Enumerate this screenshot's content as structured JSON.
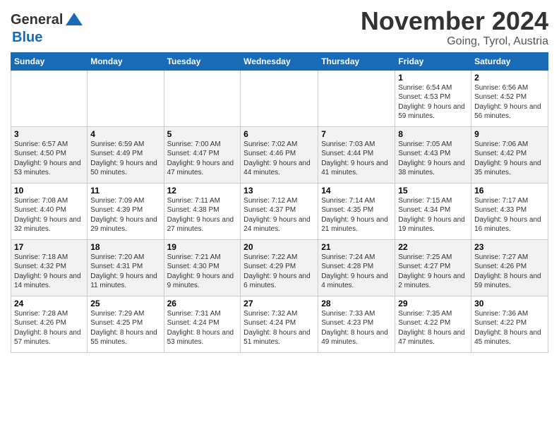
{
  "header": {
    "logo_general": "General",
    "logo_blue": "Blue",
    "month_title": "November 2024",
    "location": "Going, Tyrol, Austria"
  },
  "weekdays": [
    "Sunday",
    "Monday",
    "Tuesday",
    "Wednesday",
    "Thursday",
    "Friday",
    "Saturday"
  ],
  "weeks": [
    [
      {
        "day": "",
        "info": ""
      },
      {
        "day": "",
        "info": ""
      },
      {
        "day": "",
        "info": ""
      },
      {
        "day": "",
        "info": ""
      },
      {
        "day": "",
        "info": ""
      },
      {
        "day": "1",
        "info": "Sunrise: 6:54 AM\nSunset: 4:53 PM\nDaylight: 9 hours\nand 59 minutes."
      },
      {
        "day": "2",
        "info": "Sunrise: 6:56 AM\nSunset: 4:52 PM\nDaylight: 9 hours\nand 56 minutes."
      }
    ],
    [
      {
        "day": "3",
        "info": "Sunrise: 6:57 AM\nSunset: 4:50 PM\nDaylight: 9 hours\nand 53 minutes."
      },
      {
        "day": "4",
        "info": "Sunrise: 6:59 AM\nSunset: 4:49 PM\nDaylight: 9 hours\nand 50 minutes."
      },
      {
        "day": "5",
        "info": "Sunrise: 7:00 AM\nSunset: 4:47 PM\nDaylight: 9 hours\nand 47 minutes."
      },
      {
        "day": "6",
        "info": "Sunrise: 7:02 AM\nSunset: 4:46 PM\nDaylight: 9 hours\nand 44 minutes."
      },
      {
        "day": "7",
        "info": "Sunrise: 7:03 AM\nSunset: 4:44 PM\nDaylight: 9 hours\nand 41 minutes."
      },
      {
        "day": "8",
        "info": "Sunrise: 7:05 AM\nSunset: 4:43 PM\nDaylight: 9 hours\nand 38 minutes."
      },
      {
        "day": "9",
        "info": "Sunrise: 7:06 AM\nSunset: 4:42 PM\nDaylight: 9 hours\nand 35 minutes."
      }
    ],
    [
      {
        "day": "10",
        "info": "Sunrise: 7:08 AM\nSunset: 4:40 PM\nDaylight: 9 hours\nand 32 minutes."
      },
      {
        "day": "11",
        "info": "Sunrise: 7:09 AM\nSunset: 4:39 PM\nDaylight: 9 hours\nand 29 minutes."
      },
      {
        "day": "12",
        "info": "Sunrise: 7:11 AM\nSunset: 4:38 PM\nDaylight: 9 hours\nand 27 minutes."
      },
      {
        "day": "13",
        "info": "Sunrise: 7:12 AM\nSunset: 4:37 PM\nDaylight: 9 hours\nand 24 minutes."
      },
      {
        "day": "14",
        "info": "Sunrise: 7:14 AM\nSunset: 4:35 PM\nDaylight: 9 hours\nand 21 minutes."
      },
      {
        "day": "15",
        "info": "Sunrise: 7:15 AM\nSunset: 4:34 PM\nDaylight: 9 hours\nand 19 minutes."
      },
      {
        "day": "16",
        "info": "Sunrise: 7:17 AM\nSunset: 4:33 PM\nDaylight: 9 hours\nand 16 minutes."
      }
    ],
    [
      {
        "day": "17",
        "info": "Sunrise: 7:18 AM\nSunset: 4:32 PM\nDaylight: 9 hours\nand 14 minutes."
      },
      {
        "day": "18",
        "info": "Sunrise: 7:20 AM\nSunset: 4:31 PM\nDaylight: 9 hours\nand 11 minutes."
      },
      {
        "day": "19",
        "info": "Sunrise: 7:21 AM\nSunset: 4:30 PM\nDaylight: 9 hours\nand 9 minutes."
      },
      {
        "day": "20",
        "info": "Sunrise: 7:22 AM\nSunset: 4:29 PM\nDaylight: 9 hours\nand 6 minutes."
      },
      {
        "day": "21",
        "info": "Sunrise: 7:24 AM\nSunset: 4:28 PM\nDaylight: 9 hours\nand 4 minutes."
      },
      {
        "day": "22",
        "info": "Sunrise: 7:25 AM\nSunset: 4:27 PM\nDaylight: 9 hours\nand 2 minutes."
      },
      {
        "day": "23",
        "info": "Sunrise: 7:27 AM\nSunset: 4:26 PM\nDaylight: 8 hours\nand 59 minutes."
      }
    ],
    [
      {
        "day": "24",
        "info": "Sunrise: 7:28 AM\nSunset: 4:26 PM\nDaylight: 8 hours\nand 57 minutes."
      },
      {
        "day": "25",
        "info": "Sunrise: 7:29 AM\nSunset: 4:25 PM\nDaylight: 8 hours\nand 55 minutes."
      },
      {
        "day": "26",
        "info": "Sunrise: 7:31 AM\nSunset: 4:24 PM\nDaylight: 8 hours\nand 53 minutes."
      },
      {
        "day": "27",
        "info": "Sunrise: 7:32 AM\nSunset: 4:24 PM\nDaylight: 8 hours\nand 51 minutes."
      },
      {
        "day": "28",
        "info": "Sunrise: 7:33 AM\nSunset: 4:23 PM\nDaylight: 8 hours\nand 49 minutes."
      },
      {
        "day": "29",
        "info": "Sunrise: 7:35 AM\nSunset: 4:22 PM\nDaylight: 8 hours\nand 47 minutes."
      },
      {
        "day": "30",
        "info": "Sunrise: 7:36 AM\nSunset: 4:22 PM\nDaylight: 8 hours\nand 45 minutes."
      }
    ]
  ]
}
